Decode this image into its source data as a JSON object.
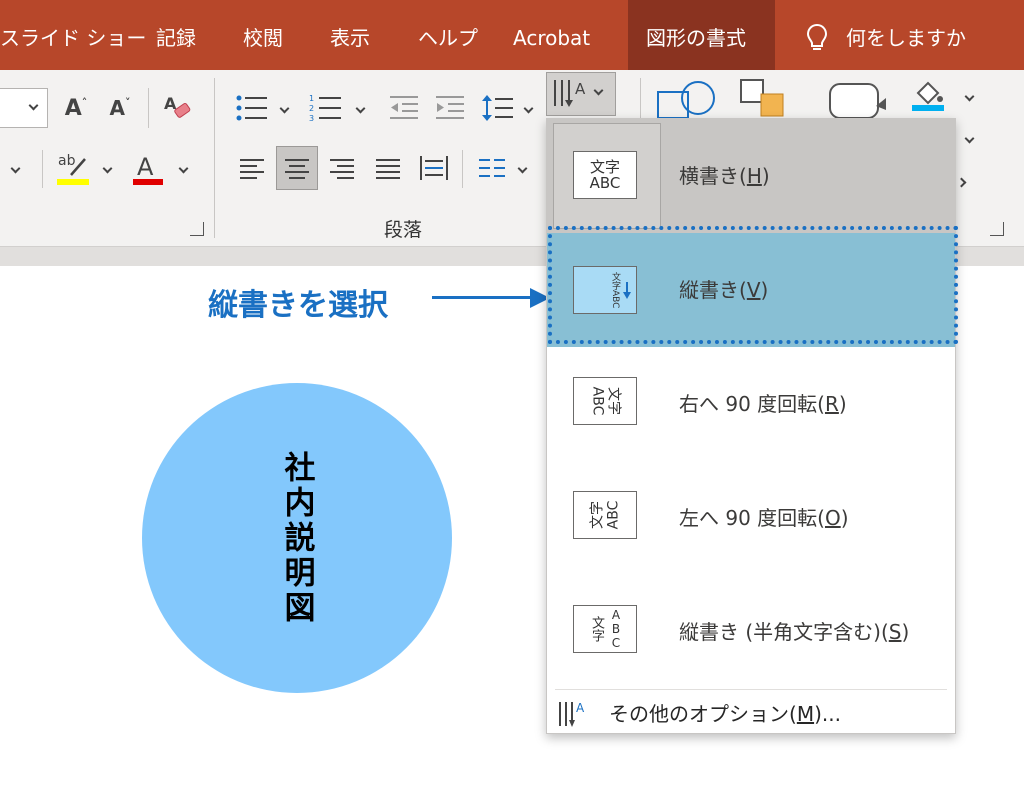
{
  "tabs": [
    {
      "label": "スライド ショー"
    },
    {
      "label": "記録"
    },
    {
      "label": "校閲"
    },
    {
      "label": "表示"
    },
    {
      "label": "ヘルプ"
    },
    {
      "label": "Acrobat"
    },
    {
      "label": "図形の書式"
    }
  ],
  "tell_me": "何をしますか",
  "ribbon": {
    "paragraph_group_label": "段落"
  },
  "slide": {
    "shape_text": "社内説明図"
  },
  "annotation": "縦書きを選択",
  "menu": {
    "items": [
      {
        "label": "横書き(",
        "key": "H",
        "suffix": ")",
        "icon": "文字\nABC"
      },
      {
        "label": "縦書き(",
        "key": "V",
        "suffix": ")",
        "icon": "文字ABC"
      },
      {
        "label": "右へ 90 度回転(",
        "key": "R",
        "suffix": ")",
        "icon": "文字\nABC"
      },
      {
        "label": "左へ 90 度回転(",
        "key": "O",
        "suffix": ")",
        "icon": "文字\nABC"
      },
      {
        "label": "縦書き (半角文字含む)(",
        "key": "S",
        "suffix": ")",
        "icon_a": "文字",
        "icon_b": "ABC"
      }
    ],
    "more": {
      "label": "その他のオプション(",
      "key": "M",
      "suffix": ")..."
    }
  },
  "colors": {
    "tab_bar": "#b7472a",
    "tab_active": "#8a3320",
    "shape_fill": "#83c8fc",
    "selected_item": "#88bfd4",
    "annotation": "#1a70c3",
    "highlight_yellow": "#ffff00",
    "font_color_red": "#e00000"
  }
}
